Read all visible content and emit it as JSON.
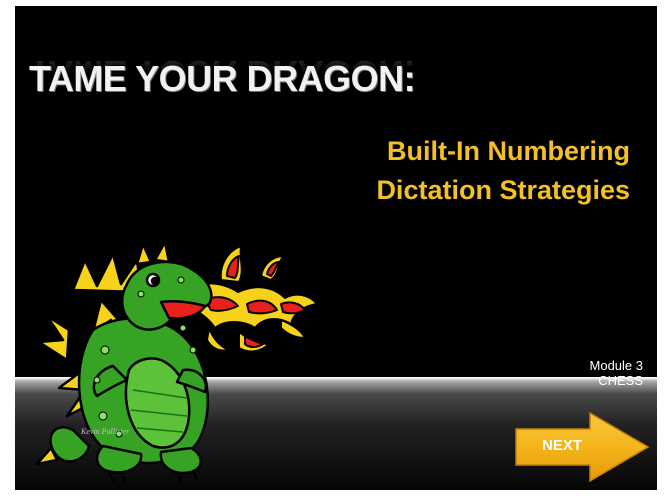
{
  "slide": {
    "title": "TAME YOUR DRAGON:",
    "subtitle_line1": "Built-In Numbering",
    "subtitle_line2": "Dictation Strategies",
    "module_line1": "Module 3",
    "module_line2": "CHESS"
  },
  "illustration": {
    "icon": "dragon-icon",
    "signature": "Kevin Pallister"
  },
  "navigation": {
    "next_label": "NEXT",
    "icon": "arrow-right-icon"
  },
  "colors": {
    "background": "#000000",
    "title": "#f2f2f2",
    "subtitle": "#f3c027",
    "button": "#f4b41a",
    "dragon_green": "#37a325",
    "flame_red": "#e8211c"
  }
}
